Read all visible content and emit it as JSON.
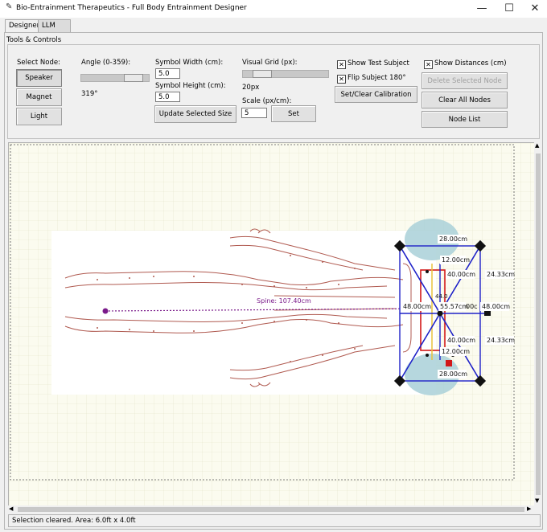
{
  "window": {
    "title": "Bio-Entrainment Therapeutics - Full Body Entrainment Designer",
    "minimize": "—",
    "maximize": "☐",
    "close": "✕"
  },
  "tabs": [
    "Designer",
    "LLM Control Panel"
  ],
  "tools": {
    "frame_label": "Tools & Controls",
    "select_node_label": "Select Node:",
    "node_buttons": [
      "Speaker",
      "Magnet",
      "Light"
    ],
    "angle_label": "Angle (0-359):",
    "angle_value": "319°",
    "angle_fraction": 0.886,
    "symbol_width_label": "Symbol Width (cm):",
    "symbol_width_value": "5.0",
    "symbol_height_label": "Symbol Height (cm):",
    "symbol_height_value": "5.0",
    "update_size_button": "Update Selected Size",
    "visual_grid_label": "Visual Grid (px):",
    "visual_grid_value": "20px",
    "grid_fraction": 0.15,
    "scale_label": "Scale (px/cm):",
    "scale_value": "5",
    "set_button": "Set",
    "show_test_subject": "Show Test Subject",
    "flip_subject": "Flip Subject 180°",
    "calibration_button": "Set/Clear Calibration",
    "show_distances": "Show Distances (cm)",
    "delete_node_button": "Delete Selected Node",
    "clear_nodes_button": "Clear All Nodes",
    "node_list_button": "Node List",
    "check_mark": "✕"
  },
  "canvas": {
    "spine_label": "Spine: 107.40cm",
    "distances": {
      "top": "28.00cm",
      "bottom": "28.00cm",
      "inner_top": "12.00cm",
      "inner_bottom": "12.00cm",
      "diag_top": "40.00cm",
      "diag_bottom": "40.00cm",
      "right_top": "24.33cm",
      "right_bottom": "24.33cm",
      "left_mid": "48.00cm",
      "right_mid": "48.00cm",
      "center": "55.57cm",
      "center_small": "44.0",
      "mid_frag": "00c"
    },
    "colors": {
      "grid": "#e3e3c8",
      "background": "#fbfbef",
      "body_outline": "#b05a50",
      "node_lines": "#1f22c8",
      "spine": "#7a1a8a",
      "pad": "#a9d0d8",
      "red_box": "#d21818",
      "yellow": "#e8c23a"
    }
  },
  "status": "Selection cleared. Area: 6.0ft x 4.0ft"
}
